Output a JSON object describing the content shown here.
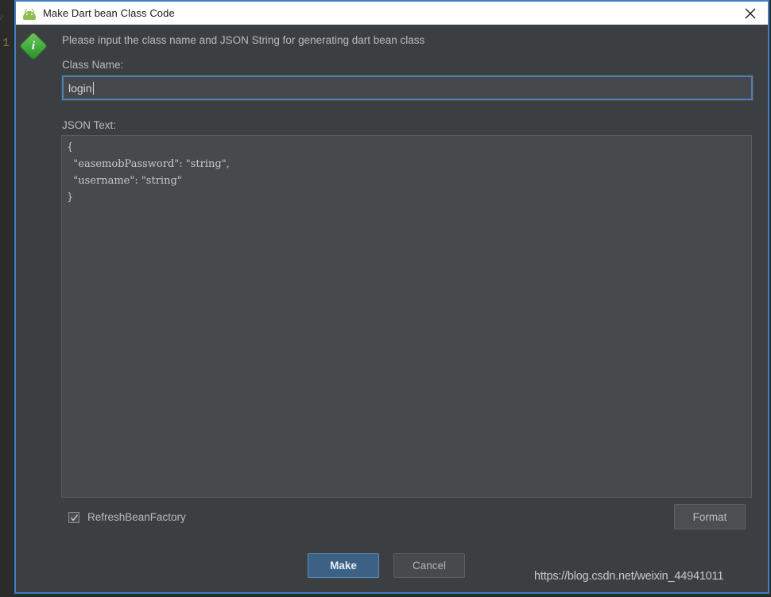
{
  "window": {
    "title": "Make Dart bean Class Code",
    "app_icon": "android-robot-icon",
    "close_icon": "close-icon",
    "accent_border_color": "#3b7fc4",
    "titlebar_bg": "#ffffff",
    "dialog_bg": "#3c3f41"
  },
  "background": {
    "editor_ghost_char": "1"
  },
  "dialog": {
    "info_icon": "info-icon",
    "info_glyph": "i",
    "prompt": "Please input the class name and JSON String for generating dart bean class",
    "class_name": {
      "label": "Class Name:",
      "value": "login",
      "placeholder": ""
    },
    "json_text": {
      "label": "JSON Text:",
      "value": "{\n  \"easemobPassword\": \"string\",\n  \"username\": \"string\"\n}",
      "placeholder": ""
    },
    "refresh_bean_factory": {
      "label": "RefreshBeanFactory",
      "checked": true,
      "check_icon": "check-icon"
    },
    "buttons": {
      "format": "Format",
      "make": "Make",
      "cancel": "Cancel"
    },
    "colors": {
      "primary_button": "#3d6185",
      "focus_ring": "#4b7fb5",
      "info_green": "#3fa93a"
    }
  },
  "watermark": {
    "text": "https://blog.csdn.net/weixin_44941011"
  }
}
